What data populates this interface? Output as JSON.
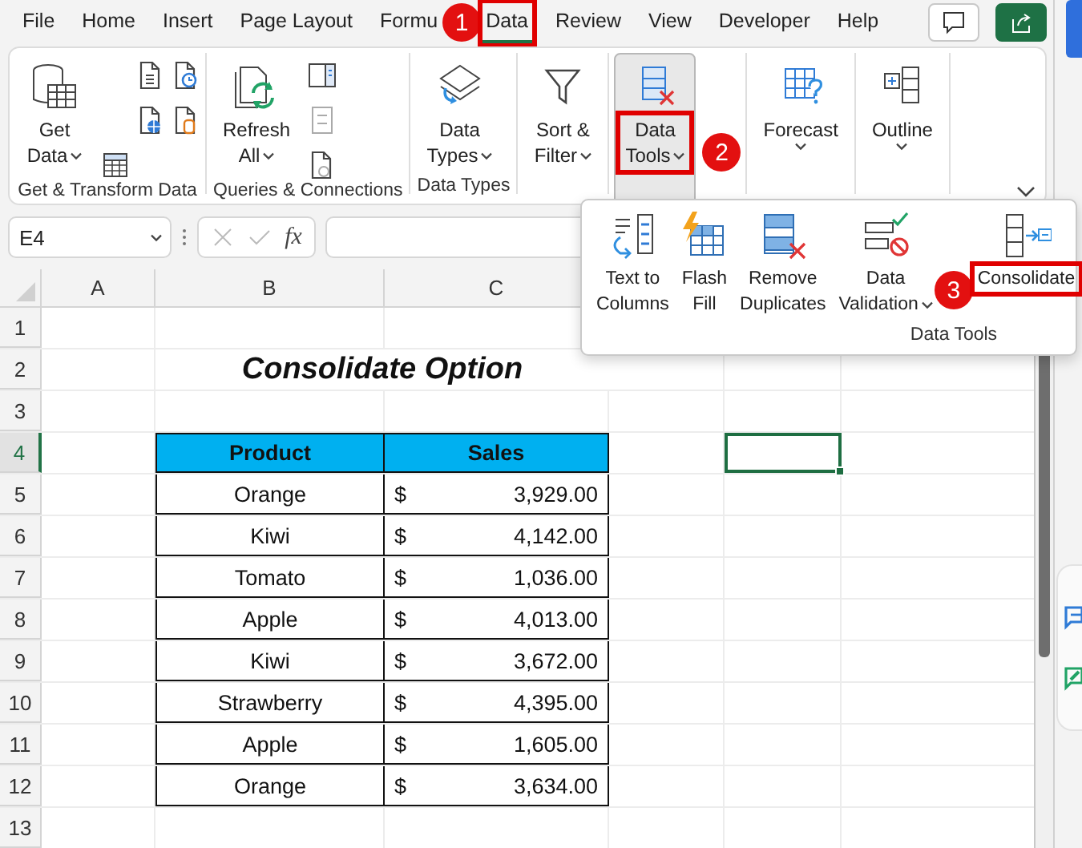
{
  "menu_tabs": [
    {
      "label": "File",
      "selected": false
    },
    {
      "label": "Home",
      "selected": false
    },
    {
      "label": "Insert",
      "selected": false
    },
    {
      "label": "Page Layout",
      "selected": false
    },
    {
      "label": "Formu",
      "selected": false
    },
    {
      "label": "Data",
      "selected": true,
      "step": "1"
    },
    {
      "label": "Review",
      "selected": false
    },
    {
      "label": "View",
      "selected": false
    },
    {
      "label": "Developer",
      "selected": false
    },
    {
      "label": "Help",
      "selected": false
    }
  ],
  "ribbon": {
    "groups": [
      {
        "label": "Get & Transform Data",
        "buttons": [
          {
            "lines": [
              "Get",
              "Data"
            ],
            "dropdown": true,
            "pressed": false
          }
        ]
      },
      {
        "label": "Queries & Connections",
        "buttons": [
          {
            "lines": [
              "Refresh",
              "All"
            ],
            "dropdown": true,
            "pressed": false
          }
        ]
      },
      {
        "label": "Data Types",
        "buttons": [
          {
            "lines": [
              "Data",
              "Types"
            ],
            "dropdown": true,
            "pressed": false
          }
        ]
      },
      {
        "buttons": [
          {
            "lines": [
              "Sort &",
              "Filter"
            ],
            "dropdown": true,
            "pressed": false
          }
        ]
      },
      {
        "buttons": [
          {
            "lines": [
              "Data",
              "Tools"
            ],
            "dropdown": true,
            "pressed": true,
            "step": "2"
          }
        ]
      },
      {
        "buttons": [
          {
            "lines": [
              "Forecast"
            ],
            "dropdown": true,
            "pressed": false
          }
        ]
      },
      {
        "buttons": [
          {
            "lines": [
              "Outline"
            ],
            "dropdown": true,
            "pressed": false
          }
        ]
      }
    ]
  },
  "dropdown_panel": {
    "label": "Data Tools",
    "buttons": [
      {
        "lines": [
          "Text to",
          "Columns"
        ],
        "dropdown": false
      },
      {
        "lines": [
          "Flash",
          "Fill"
        ],
        "dropdown": false
      },
      {
        "lines": [
          "Remove",
          "Duplicates"
        ],
        "dropdown": false
      },
      {
        "lines": [
          "Data",
          "Validation"
        ],
        "dropdown": true
      },
      {
        "lines": [
          "Consolidate"
        ],
        "dropdown": false,
        "step": "3"
      }
    ]
  },
  "formula_bar": {
    "name_box": "E4",
    "function_label": "fx"
  },
  "sheet": {
    "columns": [
      "A",
      "B",
      "C"
    ],
    "rows": [
      {
        "number": "1",
        "selected": false
      },
      {
        "number": "2",
        "selected": false
      },
      {
        "number": "3",
        "selected": false
      },
      {
        "number": "4",
        "selected": true
      },
      {
        "number": "5",
        "selected": false
      },
      {
        "number": "6",
        "selected": false
      },
      {
        "number": "7",
        "selected": false
      },
      {
        "number": "8",
        "selected": false
      },
      {
        "number": "9",
        "selected": false
      },
      {
        "number": "10",
        "selected": false
      },
      {
        "number": "11",
        "selected": false
      },
      {
        "number": "12",
        "selected": false
      },
      {
        "number": "13",
        "selected": false
      }
    ],
    "title": "Consolidate Option",
    "table": {
      "columns": [
        "Product",
        "Sales"
      ],
      "rows": [
        {
          "product": "Orange",
          "currency": "$",
          "amount": "3,929.00"
        },
        {
          "product": "Kiwi",
          "currency": "$",
          "amount": "4,142.00"
        },
        {
          "product": "Tomato",
          "currency": "$",
          "amount": "1,036.00"
        },
        {
          "product": "Apple",
          "currency": "$",
          "amount": "4,013.00"
        },
        {
          "product": "Kiwi",
          "currency": "$",
          "amount": "3,672.00"
        },
        {
          "product": "Strawberry",
          "currency": "$",
          "amount": "4,395.00"
        },
        {
          "product": "Apple",
          "currency": "$",
          "amount": "1,605.00"
        },
        {
          "product": "Orange",
          "currency": "$",
          "amount": "3,634.00"
        }
      ]
    }
  }
}
